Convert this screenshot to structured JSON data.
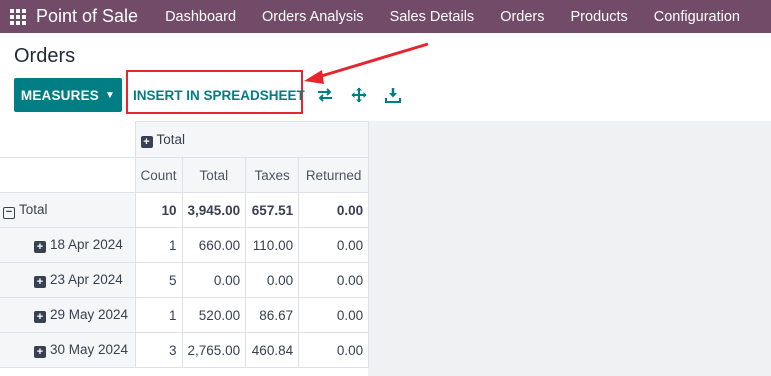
{
  "topnav": {
    "brand": "Point of Sale",
    "links": [
      "Dashboard",
      "Orders Analysis",
      "Sales Details",
      "Orders",
      "Products",
      "Configuration"
    ]
  },
  "breadcrumb": "Orders",
  "toolbar": {
    "measures_label": "MEASURES",
    "insert_label": "INSERT IN SPREADSHEET",
    "icons": [
      "flip-axis-icon",
      "expand-all-icon",
      "download-icon"
    ]
  },
  "pivot": {
    "column_group": "Total",
    "measures": [
      "Count",
      "Total",
      "Taxes",
      "Returned"
    ],
    "total_row": {
      "label": "Total",
      "values": [
        "10",
        "3,945.00",
        "657.51",
        "0.00"
      ]
    },
    "rows": [
      {
        "label": "18 Apr 2024",
        "values": [
          "1",
          "660.00",
          "110.00",
          "0.00"
        ]
      },
      {
        "label": "23 Apr 2024",
        "values": [
          "5",
          "0.00",
          "0.00",
          "0.00"
        ]
      },
      {
        "label": "29 May 2024",
        "values": [
          "1",
          "520.00",
          "86.67",
          "0.00"
        ]
      },
      {
        "label": "30 May 2024",
        "values": [
          "3",
          "2,765.00",
          "460.84",
          "0.00"
        ]
      }
    ]
  },
  "colors": {
    "brand": "#714B67",
    "accent": "#017E84",
    "annotation": "#e8242e"
  }
}
